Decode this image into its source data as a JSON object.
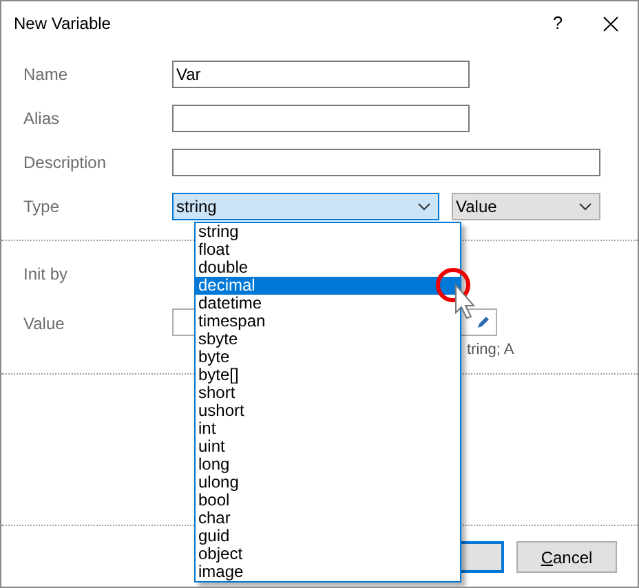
{
  "window": {
    "title": "New Variable",
    "help": "?"
  },
  "fields": [
    {
      "label": "Name",
      "value": "Var",
      "wide": false
    },
    {
      "label": "Alias",
      "wide": false
    },
    {
      "label": "Description",
      "wide": true
    }
  ],
  "type_row": {
    "label": "Type",
    "type_combo": {
      "value": "string",
      "expanded": true
    },
    "source_combo": {
      "value": "Value"
    }
  },
  "type_options": [
    {
      "label": "string",
      "selected": false
    },
    {
      "label": "float",
      "selected": false
    },
    {
      "label": "double",
      "selected": false
    },
    {
      "label": "decimal",
      "selected": true
    },
    {
      "label": "datetime",
      "selected": false
    },
    {
      "label": "timespan",
      "selected": false
    },
    {
      "label": "sbyte",
      "selected": false
    },
    {
      "label": "byte",
      "selected": false
    },
    {
      "label": "byte[]",
      "selected": false
    },
    {
      "label": "short",
      "selected": false
    },
    {
      "label": "ushort",
      "selected": false
    },
    {
      "label": "int",
      "selected": false
    },
    {
      "label": "uint",
      "selected": false
    },
    {
      "label": "long",
      "selected": false
    },
    {
      "label": "ulong",
      "selected": false
    },
    {
      "label": "bool",
      "selected": false
    },
    {
      "label": "char",
      "selected": false
    },
    {
      "label": "guid",
      "selected": false
    },
    {
      "label": "object",
      "selected": false
    },
    {
      "label": "image",
      "selected": false
    }
  ],
  "init_by": {
    "label": "Init by"
  },
  "value_row": {
    "label": "Value",
    "hint": "tring; A"
  },
  "buttons": [
    {
      "kind": "ok"
    },
    {
      "kind": "cancel",
      "label": "Cancel",
      "underline_first": true
    }
  ]
}
